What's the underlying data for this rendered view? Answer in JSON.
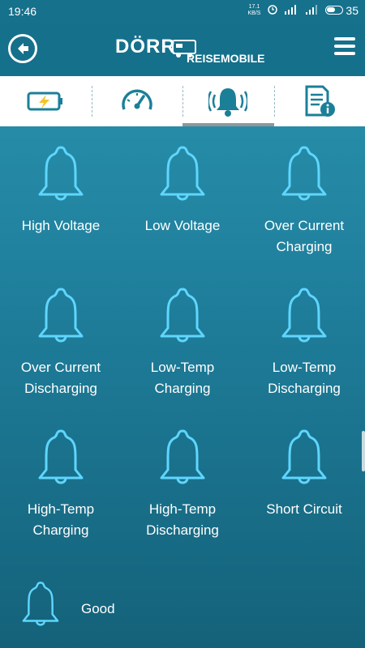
{
  "statusbar": {
    "time": "19:46",
    "speed_top": "17.1",
    "speed_bottom": "KB/S",
    "battery": "35"
  },
  "header": {
    "logo_main": "DÖRR",
    "logo_sub": "REISEMOBILE"
  },
  "tabs": [
    {
      "icon": "battery-charging-icon",
      "active": false
    },
    {
      "icon": "speedometer-icon",
      "active": false
    },
    {
      "icon": "alarm-bell-icon",
      "active": true
    },
    {
      "icon": "document-info-icon",
      "active": false
    }
  ],
  "alerts": [
    {
      "label": "High Voltage"
    },
    {
      "label": "Low Voltage"
    },
    {
      "label": "Over Current Charging"
    },
    {
      "label": "Over Current Discharging"
    },
    {
      "label": "Low-Temp Charging"
    },
    {
      "label": "Low-Temp Discharging"
    },
    {
      "label": "High-Temp Charging"
    },
    {
      "label": "High-Temp Discharging"
    },
    {
      "label": "Short Circuit"
    }
  ],
  "status_good": {
    "label": "Good"
  },
  "colors": {
    "bell_stroke": "#5fd6ff",
    "header_bg": "#15708b",
    "tab_icon": "#1b7f98",
    "page_top": "#2b95b0",
    "page_bottom": "#14627a"
  }
}
